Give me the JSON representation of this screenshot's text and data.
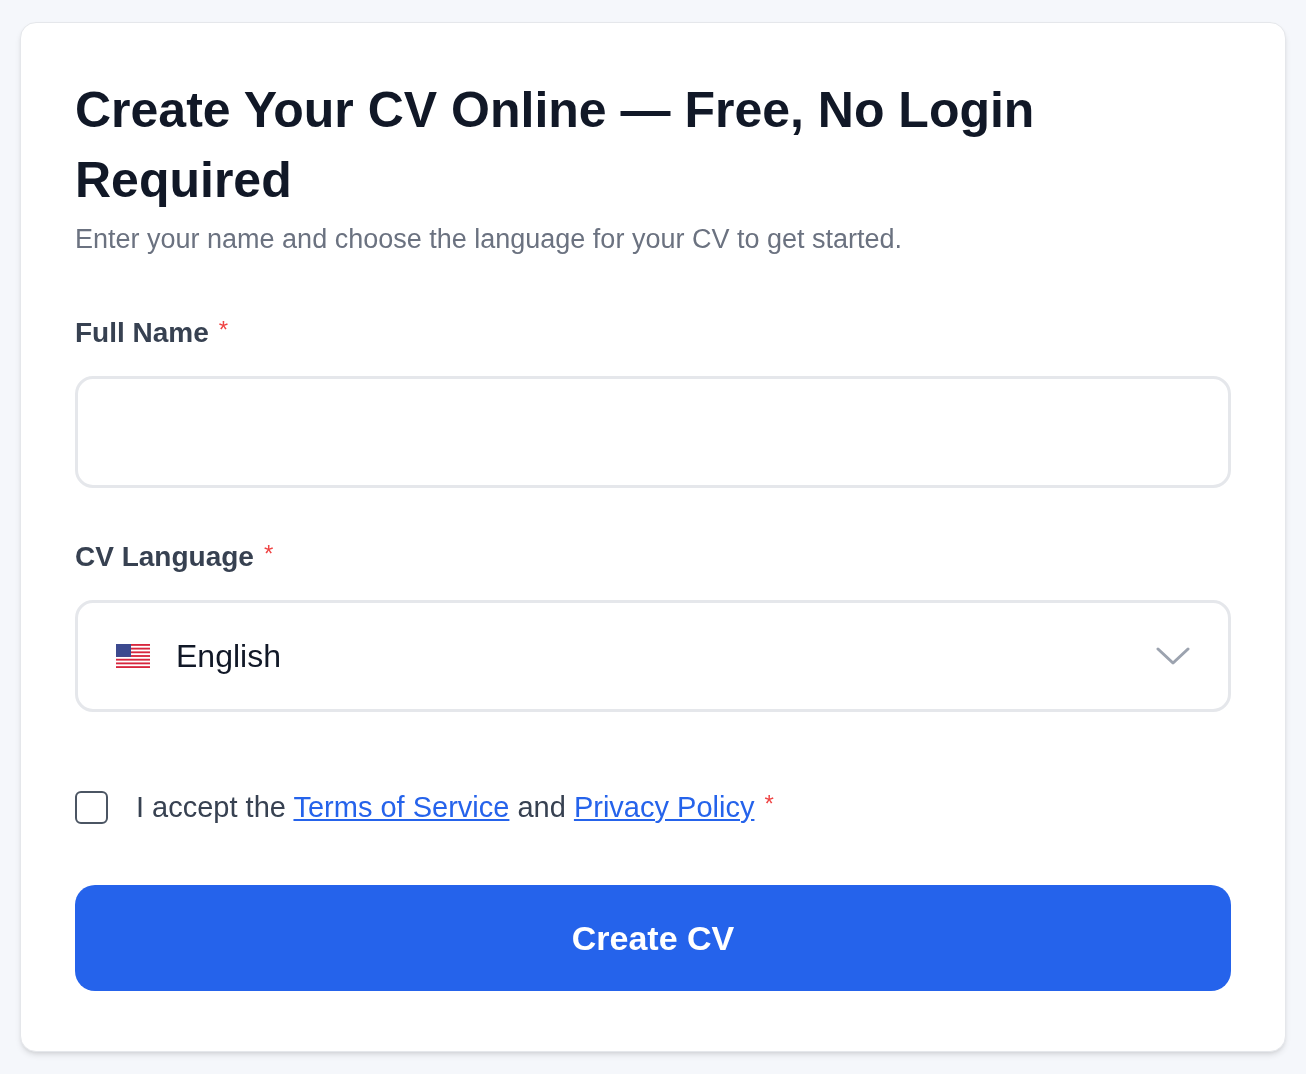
{
  "title": "Create Your CV Online — Free, No Login Required",
  "subtitle": "Enter your name and choose the language for your CV to get started.",
  "fields": [
    {
      "kind": "text",
      "label": "Full Name",
      "required_mark": "*"
    },
    {
      "kind": "select",
      "label": "CV Language",
      "required_mark": "*",
      "value": "English"
    }
  ],
  "consent": {
    "checked": false,
    "required_mark": "*",
    "parts": [
      {
        "kind": "text",
        "text": "I accept the "
      },
      {
        "kind": "link",
        "text": "Terms of Service"
      },
      {
        "kind": "text",
        "text": " and "
      },
      {
        "kind": "link",
        "text": "Privacy Policy"
      }
    ]
  },
  "button": "Create CV"
}
